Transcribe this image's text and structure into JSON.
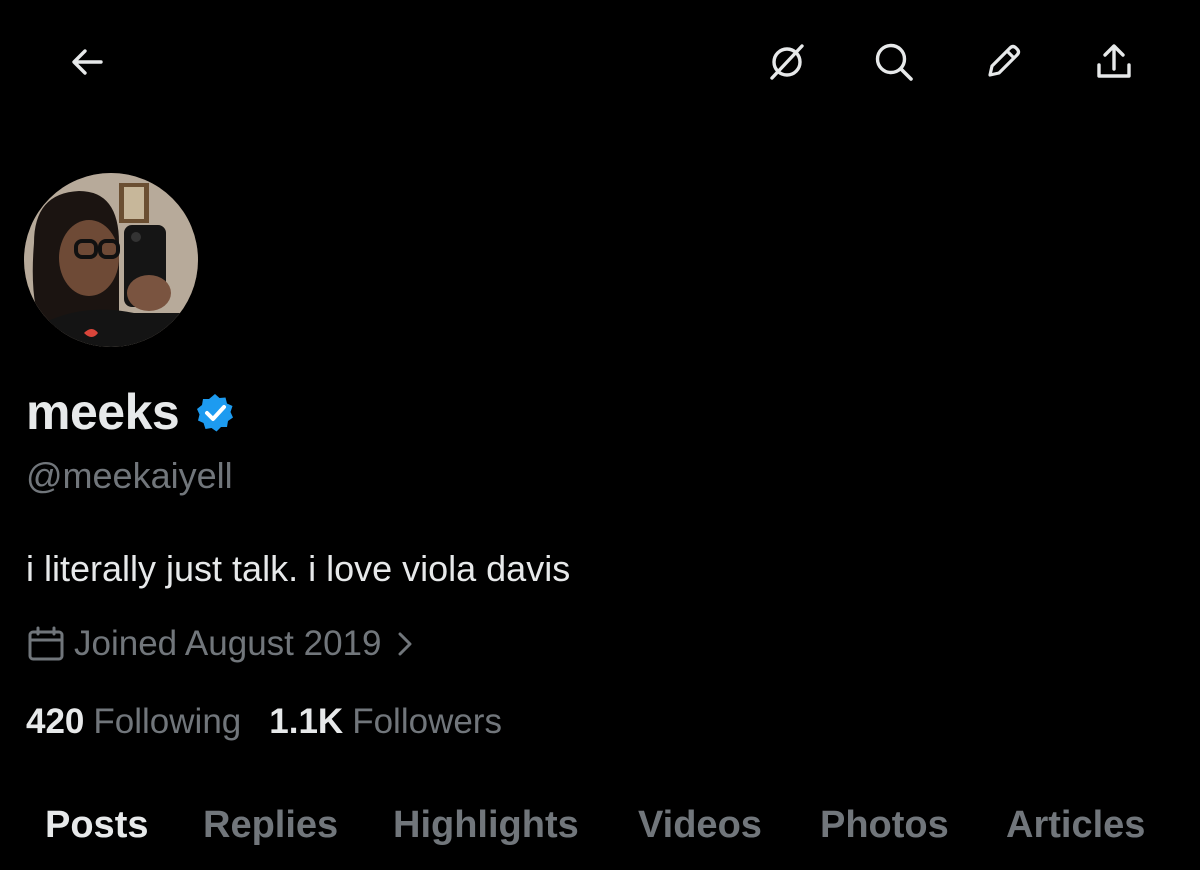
{
  "header": {
    "back_icon": "arrow-left-icon",
    "grok_icon": "grok-icon",
    "search_icon": "search-icon",
    "edit_icon": "pencil-icon",
    "share_icon": "share-icon"
  },
  "profile": {
    "display_name": "meeks",
    "verified": true,
    "verified_color": "#1d9bf0",
    "handle": "@meekaiyell",
    "bio": "i literally just talk. i love viola davis",
    "joined": "Joined August 2019",
    "following_count": "420",
    "following_label": "Following",
    "followers_count": "1.1K",
    "followers_label": "Followers"
  },
  "tabs": [
    {
      "label": "Posts",
      "active": true
    },
    {
      "label": "Replies",
      "active": false
    },
    {
      "label": "Highlights",
      "active": false
    },
    {
      "label": "Videos",
      "active": false
    },
    {
      "label": "Photos",
      "active": false
    },
    {
      "label": "Articles",
      "active": false
    }
  ],
  "colors": {
    "background": "#000000",
    "primary_text": "#e7e9ea",
    "secondary_text": "#71767b",
    "accent": "#1d9bf0"
  }
}
